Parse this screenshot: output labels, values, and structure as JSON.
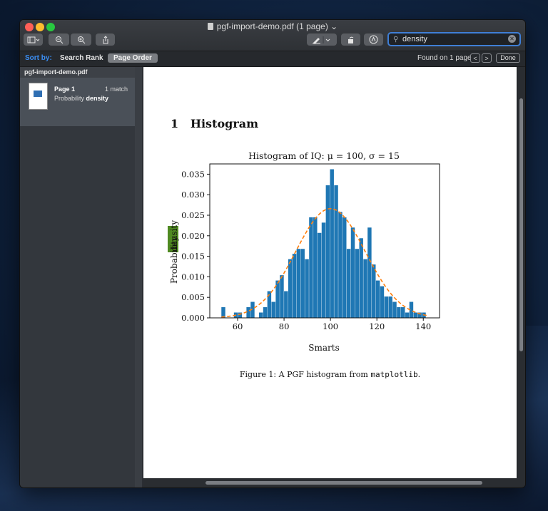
{
  "window": {
    "title": "pgf-import-demo.pdf (1 page)",
    "title_chevron": "⌄"
  },
  "toolbar": {
    "sidebar_icon": "sidebar-icon",
    "zoom_out_icon": "zoom-out-icon",
    "zoom_in_icon": "zoom-in-icon",
    "share_icon": "share-icon",
    "markup_icon": "markup-pen-icon",
    "rotate_icon": "rotate-icon",
    "annotate_icon": "annotate-icon",
    "search_value": "density"
  },
  "findbar": {
    "sort_by": "Sort by:",
    "search_rank": "Search Rank",
    "page_order": "Page Order",
    "found": "Found on 1 page",
    "prev": "<",
    "next": ">",
    "done": "Done"
  },
  "sidebar": {
    "doc_name": "pgf-import-demo.pdf",
    "result": {
      "page": "Page 1",
      "matches": "1 match",
      "snippet_prefix": "Probability ",
      "snippet_hit": "density"
    }
  },
  "page": {
    "section_number": "1",
    "section_title": "Histogram",
    "caption_prefix": "Figure 1: A PGF histogram from ",
    "caption_code": "matplotlib",
    "caption_suffix": "."
  },
  "chart_data": {
    "type": "bar",
    "title": "Histogram of IQ: μ = 100, σ = 15",
    "xlabel": "Smarts",
    "ylabel_prefix": "Probability ",
    "ylabel_highlight": "density",
    "xlim": [
      48,
      147
    ],
    "ylim": [
      0,
      0.0375
    ],
    "xticks": [
      60,
      80,
      100,
      120,
      140
    ],
    "yticks": [
      "0.000",
      "0.005",
      "0.010",
      "0.015",
      "0.020",
      "0.025",
      "0.030",
      "0.035"
    ],
    "bin_start": 53,
    "bin_width": 1.8,
    "values": [
      0.0026,
      0,
      0,
      0.0013,
      0.0013,
      0,
      0.0026,
      0.0039,
      0,
      0.0013,
      0.0026,
      0.0065,
      0.0039,
      0.0091,
      0.0104,
      0.0065,
      0.0143,
      0.0156,
      0.0168,
      0.0168,
      0.0143,
      0.0245,
      0.0245,
      0.0207,
      0.0232,
      0.0323,
      0.0362,
      0.0323,
      0.0258,
      0.0245,
      0.0168,
      0.022,
      0.0168,
      0.0194,
      0.0143,
      0.022,
      0.013,
      0.0091,
      0.0077,
      0.0052,
      0.0052,
      0.0039,
      0.0026,
      0.0026,
      0.0013,
      0.0039,
      0.0013,
      0.0013,
      0.0013
    ],
    "fit_series": {
      "type": "normal-pdf",
      "mu": 100,
      "sigma": 15,
      "color": "#ff7f0e",
      "style": "dashed"
    },
    "bar_color": "#1f77b4",
    "highlight_color": "#4f8a21"
  }
}
